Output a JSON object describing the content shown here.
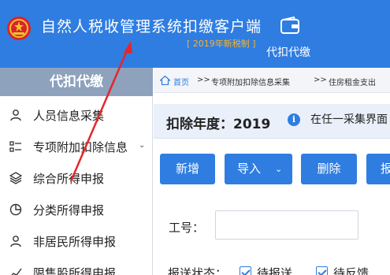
{
  "header": {
    "title": "自然人税收管理系统扣缴客户端",
    "subtitle": "[ 2019年新税制 ]",
    "module": "代扣代缴",
    "colors": {
      "background": "#2f7de1",
      "subtitle": "#ffb020"
    },
    "icons": {
      "emblem": "national-emblem",
      "module": "wallet-icon"
    }
  },
  "sidebar": {
    "heading": "代扣代缴",
    "items": [
      {
        "label": "人员信息采集",
        "icon": "person-icon"
      },
      {
        "label": "专项附加扣除信息",
        "icon": "list-icon",
        "has_chevron": true
      },
      {
        "label": "综合所得申报",
        "icon": "layers-icon"
      },
      {
        "label": "分类所得申报",
        "icon": "pie-icon"
      },
      {
        "label": "非居民所得申报",
        "icon": "person-icon"
      },
      {
        "label": "限售股所得申报",
        "icon": "stock-icon"
      }
    ]
  },
  "breadcrumb": {
    "home": "首页",
    "separator": ">>",
    "items": [
      "专项附加扣除信息采集",
      "住房租金支出"
    ]
  },
  "yearbar": {
    "label": "扣除年度：2019",
    "info": "i",
    "notice": "在任一采集界面"
  },
  "toolbar": {
    "add": "新增",
    "import": "导入",
    "delete": "删除",
    "more": "报"
  },
  "form": {
    "id_label": "工号：",
    "id_value": "",
    "status_label": "报送状态：",
    "status_options": [
      {
        "label": "待报送",
        "checked": true
      },
      {
        "label": "待反馈",
        "checked": true
      }
    ]
  }
}
